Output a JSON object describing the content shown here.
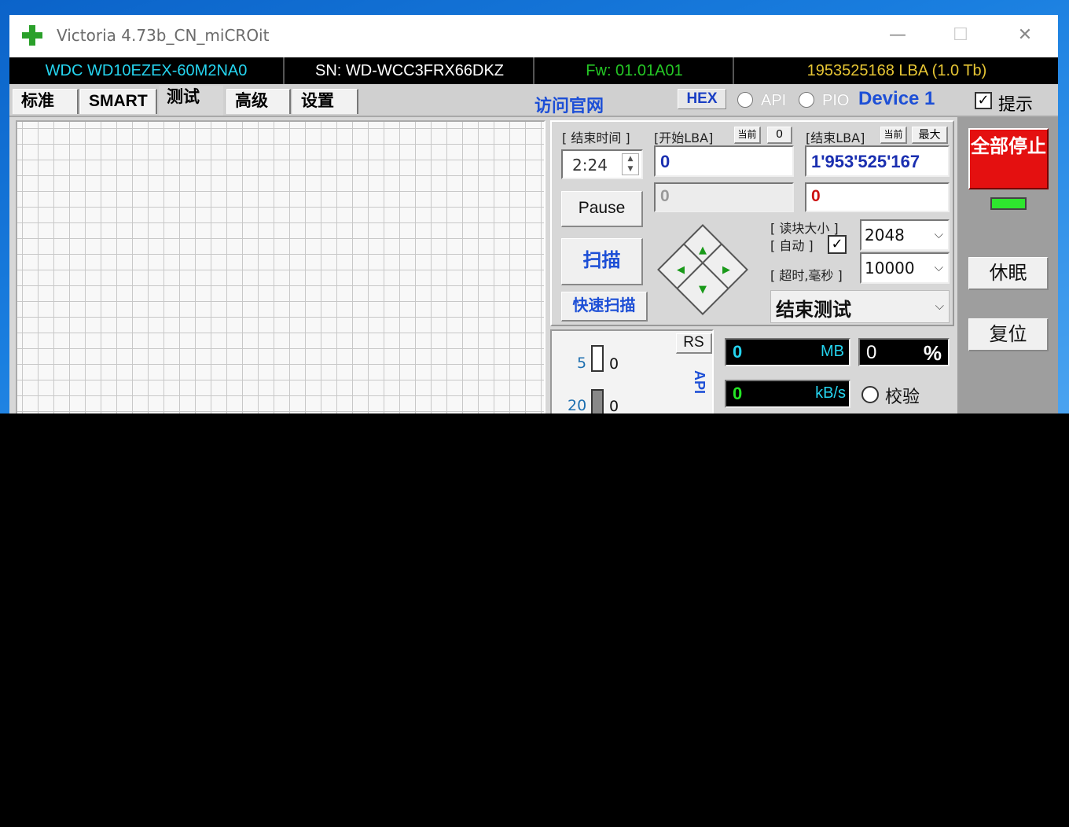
{
  "window": {
    "title": "Victoria 4.73b_CN_miCROit",
    "minimize_glyph": "—",
    "maximize_glyph": "☐",
    "close_glyph": "✕"
  },
  "drive_info": {
    "model": "WDC WD10EZEX-60M2NA0",
    "serial": "SN: WD-WCC3FRX66DKZ",
    "firmware": "Fw: 01.01A01",
    "capacity": "1953525168 LBA (1.0 Tb)"
  },
  "tabs": [
    {
      "label": "标准"
    },
    {
      "label": "SMART"
    },
    {
      "label": "测试",
      "active": true
    },
    {
      "label": "高级"
    },
    {
      "label": "设置"
    }
  ],
  "toolbar": {
    "site_link": "访问官网",
    "hex_label": "HEX",
    "api_label": "API",
    "pio_label": "PIO",
    "device_label": "Device 1",
    "hint_label": "提示",
    "hint_checked": true
  },
  "test": {
    "end_time_label": "[ 结束时间 ]",
    "end_time_value": "2:24",
    "start_lba_label": "[开始LBA]",
    "end_lba_label": "[结束LBA]",
    "current_btn_label": "当前",
    "zero_btn_label": "0",
    "max_btn_label": "最大",
    "start_lba_value": "0",
    "end_lba_value": "1'953'525'167",
    "gray_field_value": "0",
    "red_field_value": "0",
    "pause_label": "Pause",
    "scan_label": "扫描",
    "quick_scan_label": "快速扫描",
    "block_size_label": "[ 读块大小 ]",
    "auto_label": "[ 自动 ]",
    "auto_checked": true,
    "block_size_value": "2048",
    "timeout_label": "[ 超时,毫秒 ]",
    "timeout_value": "10000",
    "end_action_value": "结束测试"
  },
  "right_panel": {
    "stop_all_label": "全部停止",
    "sleep_label": "休眠",
    "reset_label": "复位",
    "led_color": "#2ee62e"
  },
  "stats": {
    "rs_label": "RS",
    "ms_rows": [
      {
        "label": "5",
        "count": "0"
      },
      {
        "label": "20",
        "count": "0"
      }
    ],
    "vertical_text": "API",
    "mb_value": "0",
    "mb_unit": "MB",
    "percent_value": "0",
    "percent_unit": "%",
    "speed_value": "0",
    "speed_unit": "kB/s",
    "verify_label": "校验"
  },
  "icons": {
    "app": "green-plus-icon",
    "dpad_up": "▲",
    "dpad_left": "◀",
    "dpad_right": "▶",
    "dpad_down": "▼",
    "dropdown": "⌵",
    "checkmark": "✓",
    "spin_up": "▲",
    "spin_down": "▼"
  },
  "colors": {
    "model": "#25d4ef",
    "firmware": "#25c725",
    "capacity": "#e6c534",
    "stop_button": "#e41010",
    "link_blue": "#1d4fd6"
  }
}
